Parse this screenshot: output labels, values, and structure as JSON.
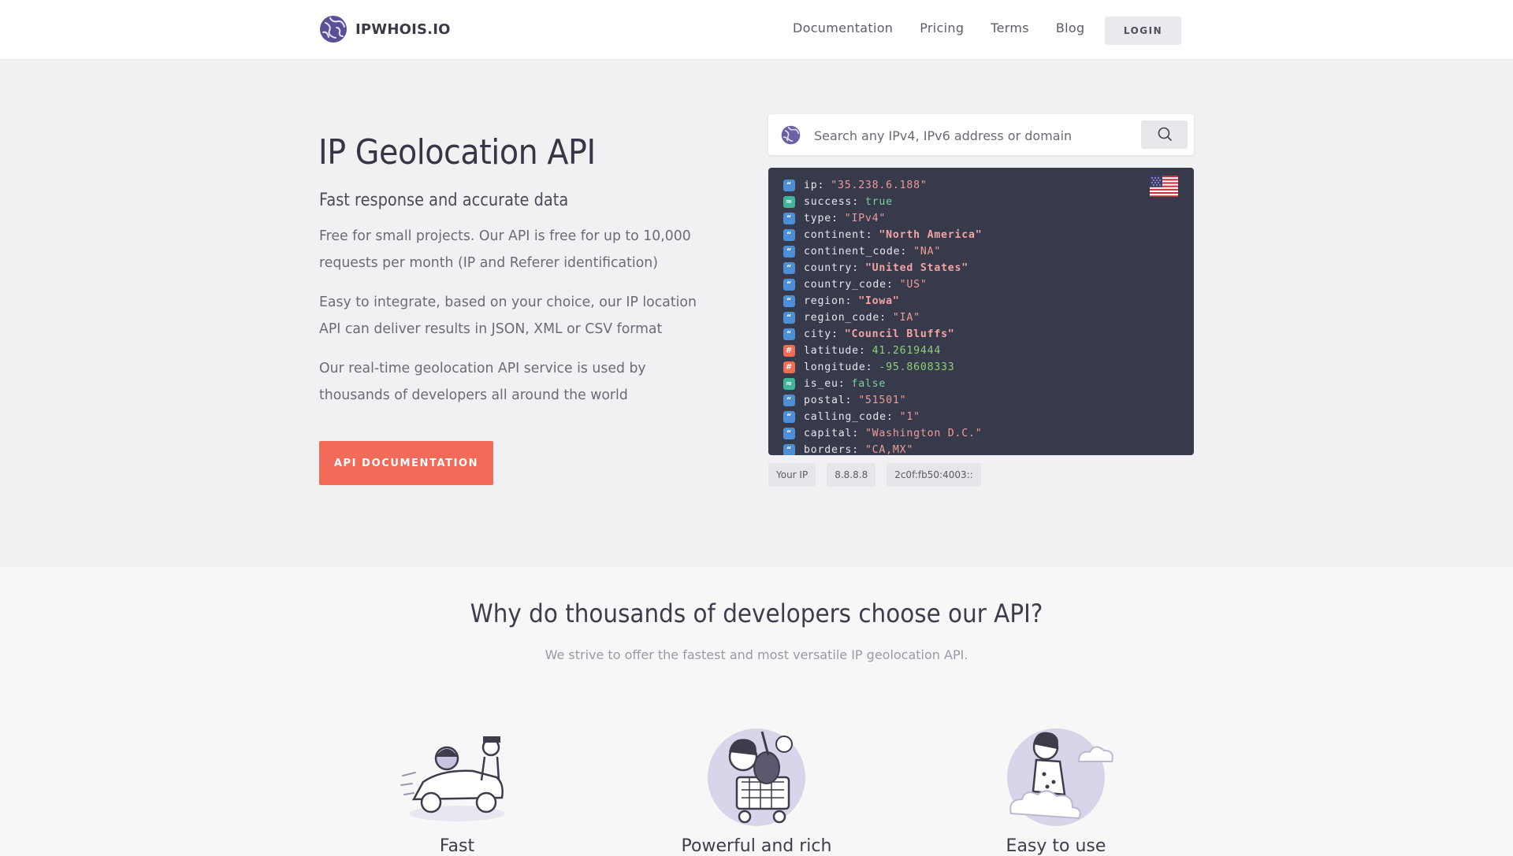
{
  "header": {
    "brand": "IPWHOIS.IO",
    "nav": [
      "Documentation",
      "Pricing",
      "Terms",
      "Blog"
    ],
    "login": "LOGIN"
  },
  "hero": {
    "title": "IP Geolocation API",
    "subtitle": "Fast response and accurate data",
    "paragraphs": [
      "Free for small projects. Our API is free for up to 10,000 requests per month (IP and Referer identification)",
      "Easy to integrate, based on your choice, our IP location API can deliver results in JSON, XML or CSV format",
      "Our real-time geolocation API service is used by thousands of developers all around the world"
    ],
    "cta": "API DOCUMENTATION"
  },
  "search": {
    "placeholder": "Search any IPv4, IPv6 address or domain"
  },
  "response": {
    "flag": "us-flag",
    "rows": [
      {
        "key": "ip",
        "value": "\"35.238.6.188\"",
        "type": "string",
        "bold": false
      },
      {
        "key": "success",
        "value": "true",
        "type": "bool",
        "bold": false
      },
      {
        "key": "type",
        "value": "\"IPv4\"",
        "type": "string",
        "bold": false
      },
      {
        "key": "continent",
        "value": "\"North America\"",
        "type": "string",
        "bold": true
      },
      {
        "key": "continent_code",
        "value": "\"NA\"",
        "type": "string",
        "bold": false
      },
      {
        "key": "country",
        "value": "\"United States\"",
        "type": "string",
        "bold": true
      },
      {
        "key": "country_code",
        "value": "\"US\"",
        "type": "string",
        "bold": false
      },
      {
        "key": "region",
        "value": "\"Iowa\"",
        "type": "string",
        "bold": true
      },
      {
        "key": "region_code",
        "value": "\"IA\"",
        "type": "string",
        "bold": false
      },
      {
        "key": "city",
        "value": "\"Council Bluffs\"",
        "type": "string",
        "bold": true
      },
      {
        "key": "latitude",
        "value": "41.2619444",
        "type": "number",
        "bold": false
      },
      {
        "key": "longitude",
        "value": "-95.8608333",
        "type": "number",
        "bold": false
      },
      {
        "key": "is_eu",
        "value": "false",
        "type": "bool",
        "bold": false
      },
      {
        "key": "postal",
        "value": "\"51501\"",
        "type": "string",
        "bold": false
      },
      {
        "key": "calling_code",
        "value": "\"1\"",
        "type": "string",
        "bold": false
      },
      {
        "key": "capital",
        "value": "\"Washington D.C.\"",
        "type": "string",
        "bold": false
      },
      {
        "key": "borders",
        "value": "\"CA,MX\"",
        "type": "string",
        "bold": false
      }
    ]
  },
  "chips": [
    "Your IP",
    "8.8.8.8",
    "2c0f:fb50:4003::"
  ],
  "features": {
    "title": "Why do thousands of developers choose our API?",
    "subtitle": "We strive to offer the fastest and most versatile IP geolocation API.",
    "items": [
      {
        "title": "Fast",
        "icon": "race-car-illustration-icon"
      },
      {
        "title": "Powerful and rich",
        "icon": "shopping-cart-illustration-icon"
      },
      {
        "title": "Easy to use",
        "icon": "cloud-illustration-icon"
      }
    ]
  },
  "colors": {
    "accent": "#f26b58",
    "code_background": "#363a4a",
    "hero_background": "#f1f1f3"
  }
}
